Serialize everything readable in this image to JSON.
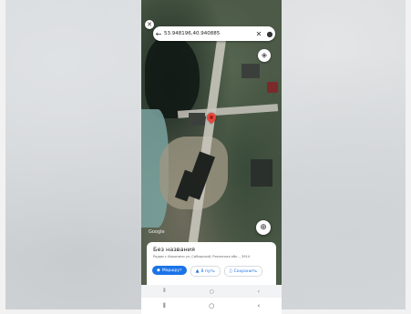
{
  "search": {
    "coords": "53.948196,40.940885"
  },
  "place": {
    "title": "Без названия",
    "address": "Рядом с Ильиничи ул.,Сибирский, Рязанская обл.., 3914"
  },
  "actions": [
    {
      "label": "Маршрут",
      "icon": "directions-icon"
    },
    {
      "label": "В путь",
      "icon": "navigation-icon"
    },
    {
      "label": "Сохранить",
      "icon": "bookmark-icon"
    }
  ],
  "map": {
    "attribution": "Google"
  },
  "colors": {
    "accent": "#1a73e8",
    "pin": "#e8453c"
  }
}
